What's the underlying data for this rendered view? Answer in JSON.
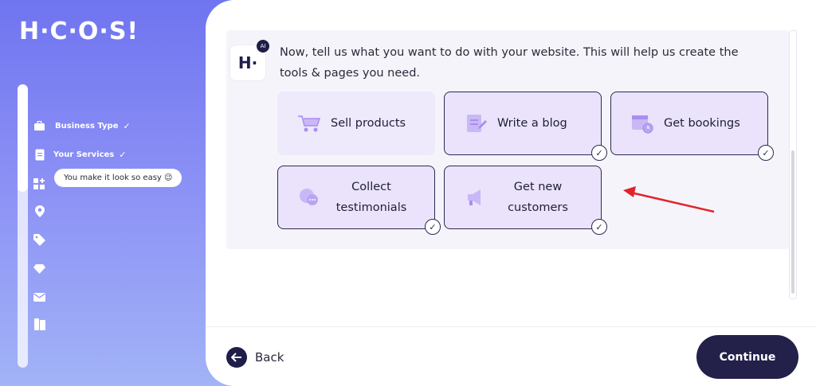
{
  "brand": {
    "logo_text": "H·C·O·S!"
  },
  "sidebar": {
    "progress": 0.38,
    "steps": [
      {
        "label": "Business Type",
        "icon": "briefcase-icon",
        "done": "✓"
      },
      {
        "label": "Your Services",
        "icon": "document-icon",
        "done": "✓"
      },
      {
        "label": "",
        "icon": "apps-icon"
      },
      {
        "label": "",
        "icon": "location-pin-icon"
      },
      {
        "label": "",
        "icon": "tag-icon"
      },
      {
        "label": "",
        "icon": "diamond-icon"
      },
      {
        "label": "",
        "icon": "mail-icon"
      },
      {
        "label": "",
        "icon": "book-icon"
      }
    ],
    "tooltip": "You make it look so easy 😉"
  },
  "assistant": {
    "avatar_text": "H·",
    "badge": "AI",
    "question": "Now, tell us what you want to do with your website. This will help us create the tools & pages you need."
  },
  "options": [
    {
      "label": "Sell products",
      "icon": "shopping-cart-icon",
      "selected": false
    },
    {
      "label": "Write a blog",
      "icon": "blog-writing-icon",
      "selected": true
    },
    {
      "label": "Get bookings",
      "icon": "calendar-clock-icon",
      "selected": true
    },
    {
      "label": "Collect testimonials",
      "icon": "chat-bubbles-icon",
      "selected": true
    },
    {
      "label": "Get new customers",
      "icon": "megaphone-icon",
      "selected": true
    }
  ],
  "footer": {
    "back_label": "Back",
    "continue_label": "Continue"
  },
  "colors": {
    "accent": "#23204a",
    "card_bg": "#eae3fb",
    "sidebar_top": "#6f74f0",
    "annotation_arrow": "#e0242b"
  }
}
